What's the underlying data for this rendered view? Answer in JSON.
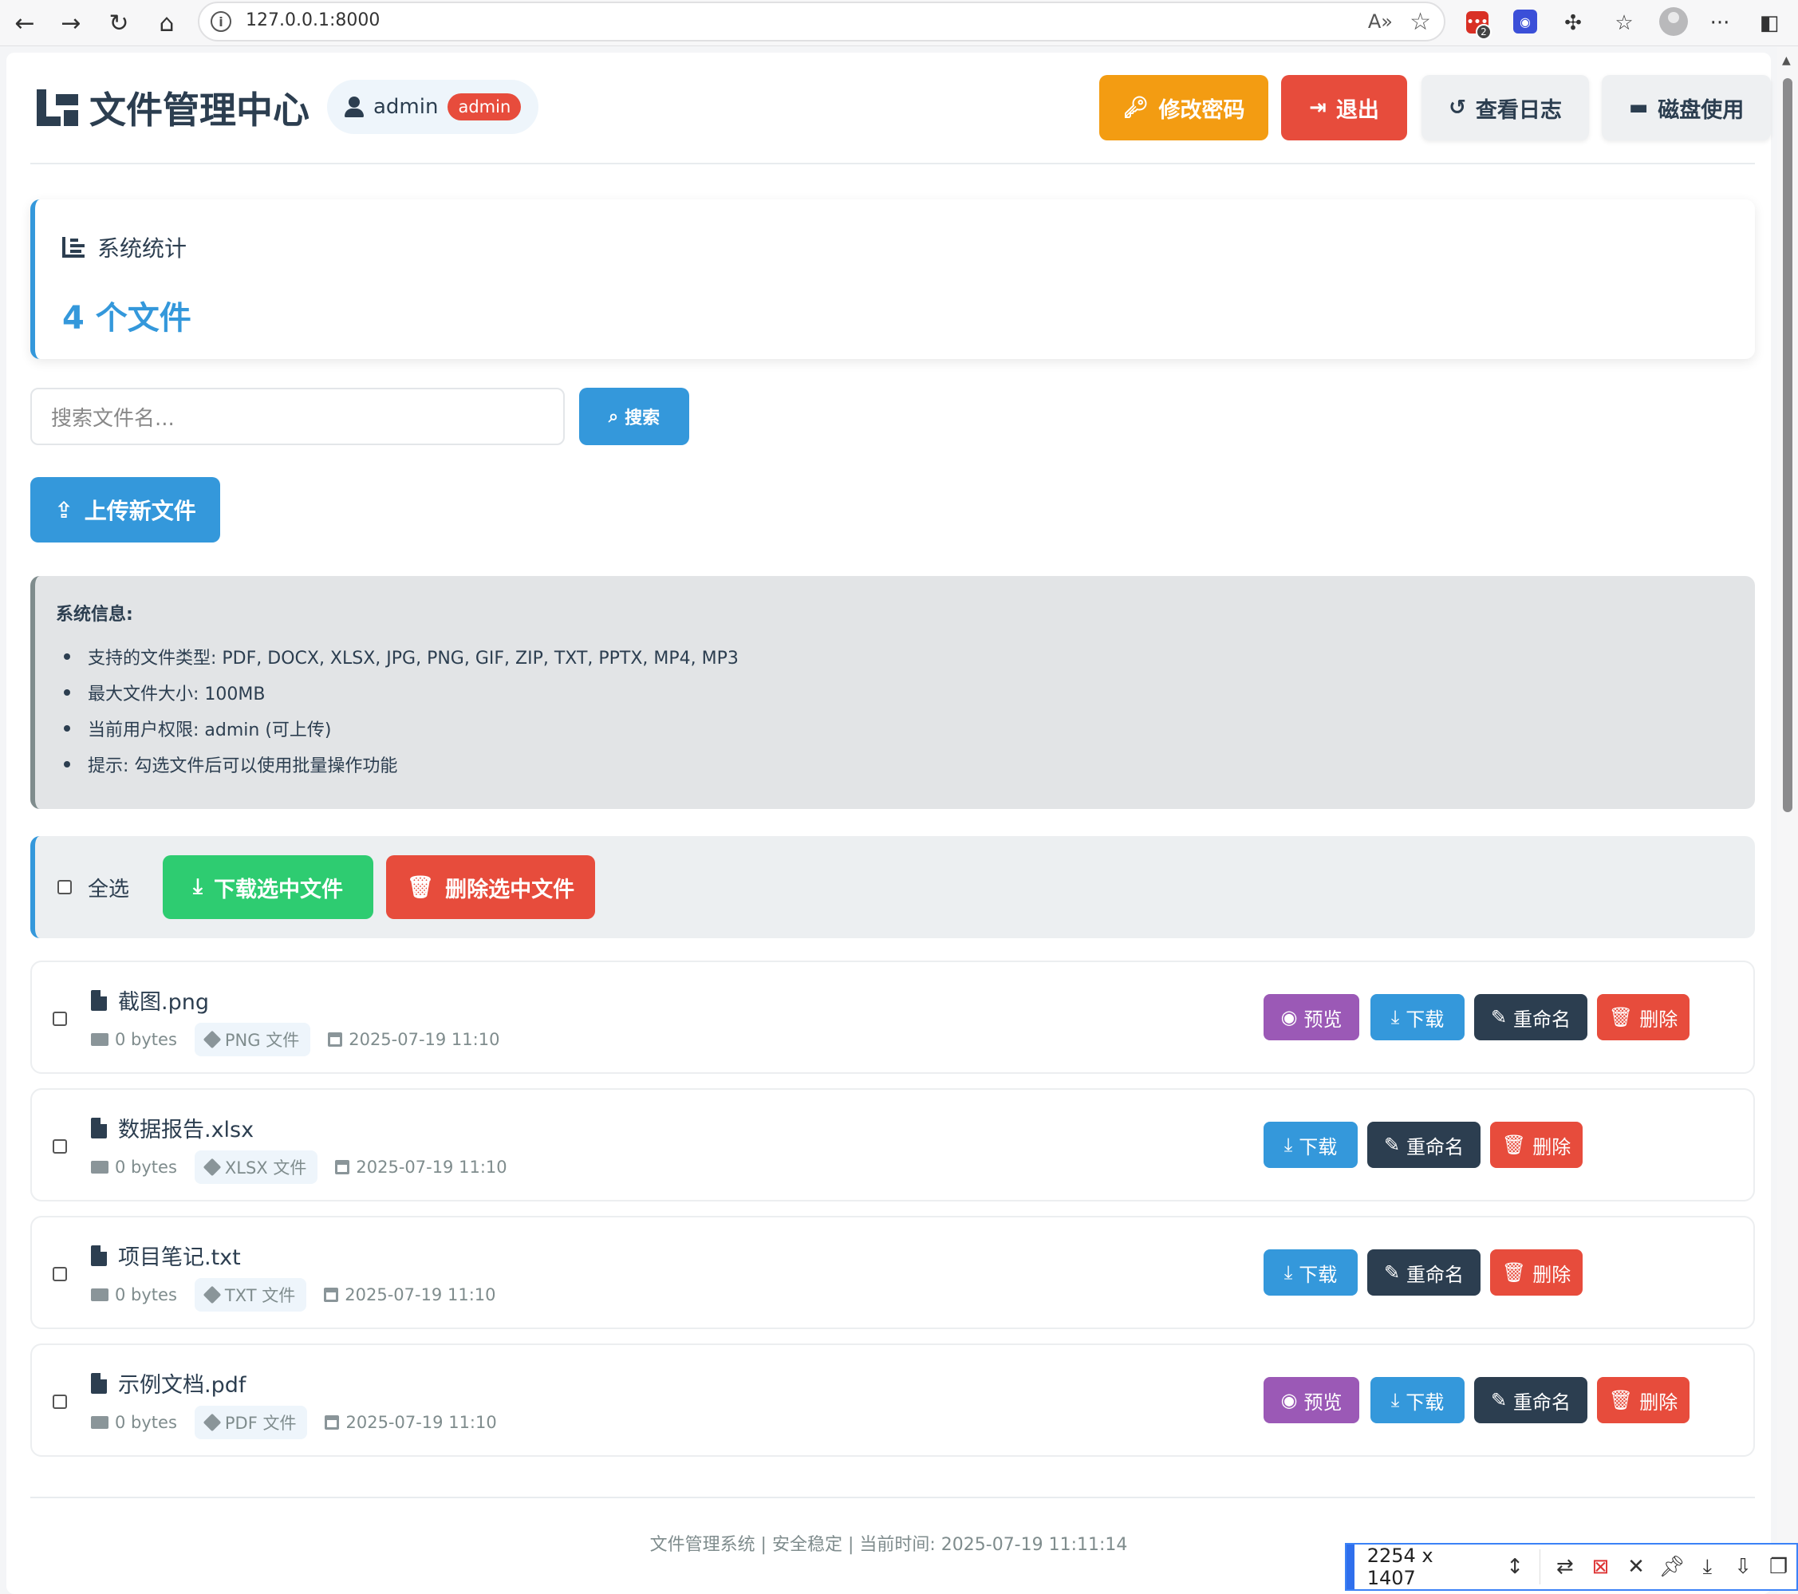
{
  "browser": {
    "url": "127.0.0.1:8000",
    "ext_badge": "2"
  },
  "header": {
    "title": "文件管理中心",
    "username": "admin",
    "role": "admin",
    "buttons": {
      "change_password": "修改密码",
      "logout": "退出",
      "view_logs": "查看日志",
      "disk_usage": "磁盘使用"
    }
  },
  "stats": {
    "label": "系统统计",
    "count": "4 个文件"
  },
  "search": {
    "placeholder": "搜索文件名...",
    "button": "搜索"
  },
  "upload": {
    "button": "上传新文件"
  },
  "sysinfo": {
    "title": "系统信息:",
    "items": [
      "支持的文件类型: PDF, DOCX, XLSX, JPG, PNG, GIF, ZIP, TXT, PPTX, MP4, MP3",
      "最大文件大小: 100MB",
      "当前用户权限: admin (可上传)",
      "提示: 勾选文件后可以使用批量操作功能"
    ]
  },
  "batch": {
    "select_all": "全选",
    "download_selected": "下载选中文件",
    "delete_selected": "删除选中文件"
  },
  "actions": {
    "preview": "预览",
    "download": "下载",
    "rename": "重命名",
    "delete": "删除"
  },
  "files": [
    {
      "name": "截图.png",
      "size": "0 bytes",
      "type": "PNG 文件",
      "date": "2025-07-19 11:10"
    },
    {
      "name": "数据报告.xlsx",
      "size": "0 bytes",
      "type": "XLSX 文件",
      "date": "2025-07-19 11:10"
    },
    {
      "name": "项目笔记.txt",
      "size": "0 bytes",
      "type": "TXT 文件",
      "date": "2025-07-19 11:10"
    },
    {
      "name": "示例文档.pdf",
      "size": "0 bytes",
      "type": "PDF 文件",
      "date": "2025-07-19 11:10"
    }
  ],
  "footer": {
    "text": "文件管理系统 | 安全稳定 | 当前时间: 2025-07-19 11:11:14"
  },
  "screenshot_toolbar": {
    "dimensions": "2254 x 1407"
  },
  "colors": {
    "primary": "#3498db",
    "danger": "#e74c3c",
    "warning": "#f39c12",
    "success": "#2ecc71",
    "purple": "#9b59b6",
    "dark": "#2c3e50"
  }
}
